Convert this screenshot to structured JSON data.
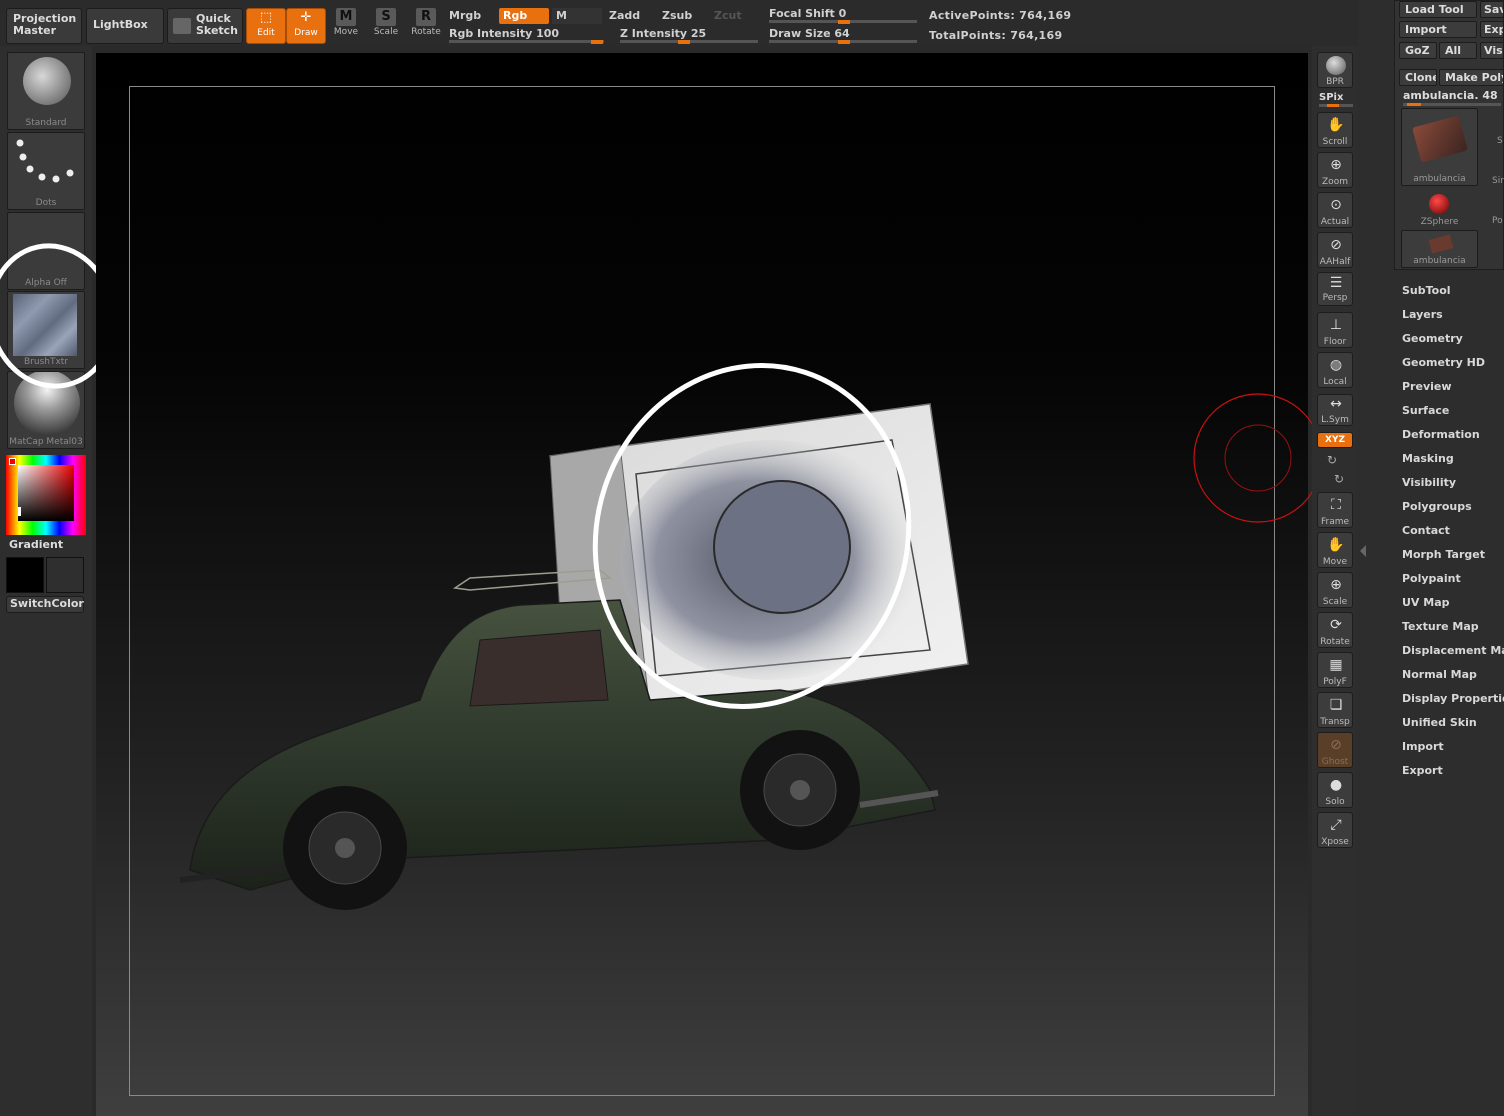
{
  "topbar": {
    "projection_master": "Projection Master",
    "lightbox": "LightBox",
    "quick_sketch": "Quick Sketch",
    "tools": {
      "edit": "Edit",
      "draw": "Draw",
      "move": "Move",
      "scale": "Scale",
      "rotate": "Rotate"
    },
    "modes": {
      "mrgb": "Mrgb",
      "rgb": "Rgb",
      "m": "M",
      "zadd": "Zadd",
      "zsub": "Zsub",
      "zcut": "Zcut"
    },
    "rgb_intensity": {
      "label": "Rgb Intensity",
      "value": "100"
    },
    "z_intensity": {
      "label": "Z Intensity",
      "value": "25"
    },
    "focal_shift": {
      "label": "Focal Shift",
      "value": "0"
    },
    "draw_size": {
      "label": "Draw Size",
      "value": "64"
    },
    "active_points": {
      "label": "ActivePoints:",
      "value": "764,169"
    },
    "total_points": {
      "label": "TotalPoints:",
      "value": "764,169"
    }
  },
  "left_shelf": {
    "brush": "Standard",
    "stroke": "Dots",
    "alpha": "Alpha  Off",
    "texture": "BrushTxtr",
    "material": "MatCap  Metal03",
    "gradient_label": "Gradient",
    "switch_color": "SwitchColor"
  },
  "right_shelf": {
    "bpr": "BPR",
    "spix": "SPix",
    "scroll": "Scroll",
    "zoom": "Zoom",
    "actual": "Actual",
    "aahalf": "AAHalf",
    "persp": "Persp",
    "floor": "Floor",
    "local": "Local",
    "lsym": "L.Sym",
    "xyz": "XYZ",
    "frame": "Frame",
    "move": "Move",
    "scale": "Scale",
    "rotate": "Rotate",
    "polyf": "PolyF",
    "transp": "Transp",
    "ghost": "Ghost",
    "solo": "Solo",
    "xpose": "Xpose"
  },
  "tool_panel": {
    "load_tool": "Load Tool",
    "save": "Sav",
    "import": "Import",
    "export": "Exp",
    "goz": "GoZ",
    "all": "All",
    "visible": "Visi",
    "clone": "Clone",
    "make_polymesh": "Make Polyi",
    "current_tool": "ambulancia. 48",
    "thumbs": [
      {
        "caption": "ambulancia"
      },
      {
        "caption": "ZSphere"
      },
      {
        "caption": "ambulancia"
      }
    ],
    "side_captions": [
      "S",
      "Sir",
      "Po"
    ],
    "menu": [
      "SubTool",
      "Layers",
      "Geometry",
      "Geometry HD",
      "Preview",
      "Surface",
      "Deformation",
      "Masking",
      "Visibility",
      "Polygroups",
      "Contact",
      "Morph Target",
      "Polypaint",
      "UV Map",
      "Texture Map",
      "Displacement Map",
      "Normal Map",
      "Display Properties",
      "Unified Skin",
      "Import",
      "Export"
    ]
  },
  "colors": {
    "accent": "#e8700f",
    "background": "#2a2a2a",
    "cursor": "#cc1111",
    "annotation": "#ffffff"
  }
}
